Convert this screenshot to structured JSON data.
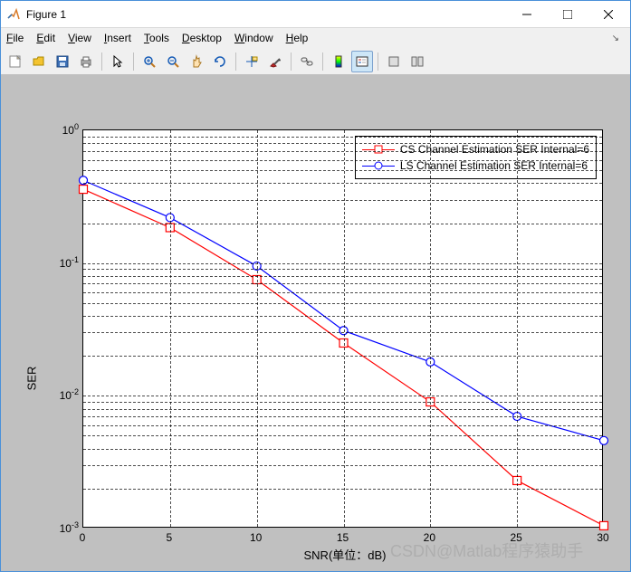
{
  "window": {
    "title": "Figure 1"
  },
  "menubar": {
    "file": "File",
    "edit": "Edit",
    "view": "View",
    "insert": "Insert",
    "tools": "Tools",
    "desktop": "Desktop",
    "window": "Window",
    "help": "Help"
  },
  "toolbar": {
    "items": [
      "new-figure",
      "open",
      "save",
      "print",
      "sep",
      "arrow",
      "sep",
      "zoom-in",
      "zoom-out",
      "pan",
      "rotate",
      "sep",
      "data-cursor",
      "brush",
      "sep",
      "link",
      "sep",
      "colorbar",
      "legend",
      "sep",
      "subplot-hide",
      "subplot-show"
    ]
  },
  "chart_data": {
    "type": "line",
    "xlabel": "SNR(单位：dB)",
    "ylabel": "SER",
    "xlim": [
      0,
      30
    ],
    "ylim": [
      0.001,
      1
    ],
    "yscale": "log",
    "xticks": [
      0,
      5,
      10,
      15,
      20,
      25,
      30
    ],
    "ytick_exponents": [
      0,
      -1,
      -2,
      -3
    ],
    "x": [
      0,
      5,
      10,
      15,
      20,
      25,
      30
    ],
    "series": [
      {
        "name": "CS Channel Estimation SER Internal=6",
        "color": "#ff0000",
        "marker": "square",
        "values": [
          0.36,
          0.185,
          0.075,
          0.025,
          0.009,
          0.0023,
          0.00105
        ]
      },
      {
        "name": "LS Channel Estimation SER Internal=6",
        "color": "#0000ff",
        "marker": "circle",
        "values": [
          0.42,
          0.22,
          0.095,
          0.031,
          0.018,
          0.007,
          0.0046
        ]
      }
    ],
    "legend_position": "top-right",
    "grid": true
  },
  "legend": {
    "items": [
      "CS Channel Estimation SER Internal=6",
      "LS Channel Estimation SER Internal=6"
    ]
  },
  "watermark": "CSDN@Matlab程序猿助手"
}
